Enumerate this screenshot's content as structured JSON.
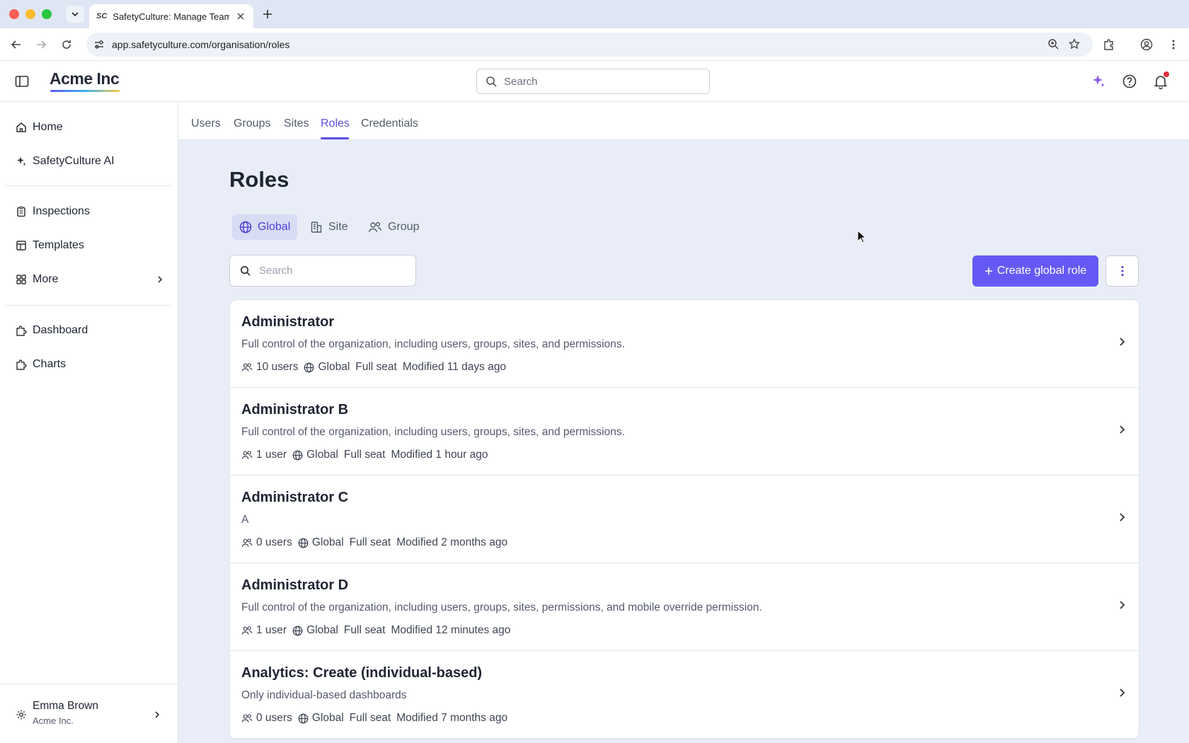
{
  "browser": {
    "tab_title": "SafetyCulture: Manage Teams",
    "tab_favicon": "SC",
    "url": "app.safetyculture.com/organisation/roles"
  },
  "header": {
    "logo": "Acme Inc",
    "search_placeholder": "Search"
  },
  "sidebar": {
    "items": [
      {
        "label": "Home",
        "icon": "home-icon"
      },
      {
        "label": "SafetyCulture AI",
        "icon": "sparkle-icon"
      },
      {
        "label": "Inspections",
        "icon": "clipboard-icon"
      },
      {
        "label": "Templates",
        "icon": "template-icon"
      },
      {
        "label": "More",
        "icon": "grid-icon"
      },
      {
        "label": "Dashboard",
        "icon": "puzzle-icon"
      },
      {
        "label": "Charts",
        "icon": "puzzle-icon"
      }
    ],
    "user": {
      "name": "Emma Brown",
      "org": "Acme Inc."
    }
  },
  "subnav": {
    "tabs": [
      "Users",
      "Groups",
      "Sites",
      "Roles",
      "Credentials"
    ],
    "active": "Roles"
  },
  "page": {
    "title": "Roles",
    "segments": [
      "Global",
      "Site",
      "Group"
    ],
    "active_segment": "Global",
    "search_placeholder": "Search",
    "create_button": "Create global role"
  },
  "roles": [
    {
      "name": "Administrator",
      "description": "Full control of the organization, including users, groups, sites, and permissions.",
      "users": "10 users",
      "scope": "Global",
      "seat": "Full seat",
      "modified": "Modified 11 days ago"
    },
    {
      "name": "Administrator B",
      "description": "Full control of the organization, including users, groups, sites, and permissions.",
      "users": "1 user",
      "scope": "Global",
      "seat": "Full seat",
      "modified": "Modified 1 hour ago"
    },
    {
      "name": "Administrator C",
      "description": "A",
      "users": "0 users",
      "scope": "Global",
      "seat": "Full seat",
      "modified": "Modified 2 months ago"
    },
    {
      "name": "Administrator D",
      "description": "Full control of the organization, including users, groups, sites, permissions, and mobile override permission.",
      "users": "1 user",
      "scope": "Global",
      "seat": "Full seat",
      "modified": "Modified 12 minutes ago"
    },
    {
      "name": "Analytics: Create (individual-based)",
      "description": "Only individual-based dashboards",
      "users": "0 users",
      "scope": "Global",
      "seat": "Full seat",
      "modified": "Modified 7 months ago"
    }
  ],
  "colors": {
    "accent": "#6559f5",
    "active_text": "#5a4fe0",
    "background": "#e9edf7"
  }
}
